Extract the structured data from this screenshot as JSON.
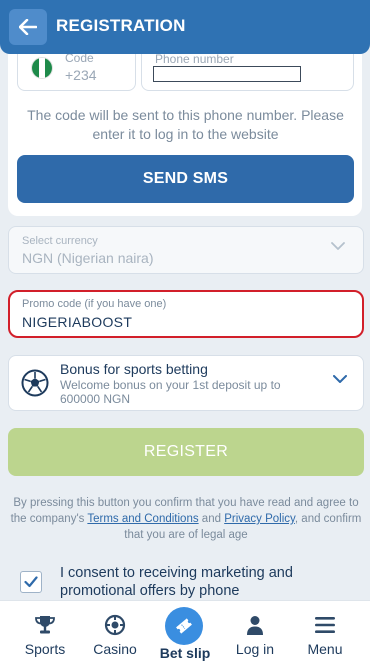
{
  "header": {
    "title": "REGISTRATION"
  },
  "phone": {
    "code_label": "Code",
    "code_value": "+234",
    "number_label": "Phone number",
    "number_value": "",
    "hint": "The code will be sent to this phone number. Please enter it to log in to the website",
    "send_button": "SEND SMS"
  },
  "currency": {
    "label": "Select currency",
    "value": "NGN  (Nigerian naira)"
  },
  "promo": {
    "label": "Promo code (if you have one)",
    "value": "NIGERIABOOST"
  },
  "bonus": {
    "title": "Bonus for sports betting",
    "description": "Welcome bonus on your 1st deposit up to 600000 NGN"
  },
  "register_button": "REGISTER",
  "terms": {
    "prefix": "By pressing this button you confirm that you have read and agree to the company's ",
    "terms_link": "Terms and Conditions",
    "and": " and ",
    "privacy_link": "Privacy Policy",
    "suffix": ", and confirm that you are of legal age"
  },
  "consent": {
    "checked": true,
    "text": "I consent to receiving marketing and promotional offers by phone"
  },
  "nav": {
    "items": [
      {
        "label": "Sports",
        "icon": "trophy-icon"
      },
      {
        "label": "Casino",
        "icon": "roulette-icon"
      },
      {
        "label": "Bet slip",
        "icon": "ticket-icon"
      },
      {
        "label": "Log in",
        "icon": "user-icon"
      },
      {
        "label": "Menu",
        "icon": "menu-icon"
      }
    ]
  },
  "colors": {
    "header": "#2f72b3",
    "primary_button": "#2f6aaa",
    "register_button": "#bcd58e",
    "promo_border": "#d21f2a",
    "betslip": "#3a8ee0"
  }
}
